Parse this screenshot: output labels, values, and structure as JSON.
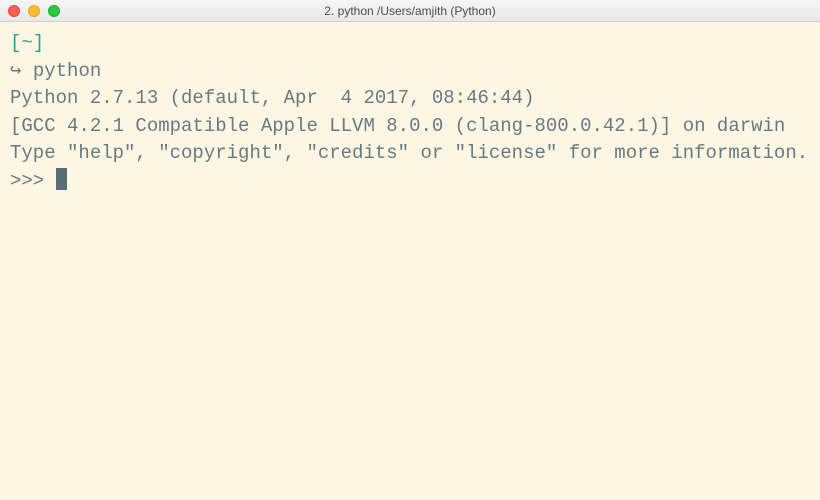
{
  "window": {
    "title": "2. python  /Users/amjith (Python)"
  },
  "terminal": {
    "prompt_dir": "[~]",
    "prompt_arrow": "↪ ",
    "command": "python",
    "output_line1": "Python 2.7.13 (default, Apr  4 2017, 08:46:44)",
    "output_line2": "[GCC 4.2.1 Compatible Apple LLVM 8.0.0 (clang-800.0.42.1)] on darwin",
    "output_line3": "Type \"help\", \"copyright\", \"credits\" or \"license\" for more information.",
    "repl_prompt": ">>> "
  }
}
